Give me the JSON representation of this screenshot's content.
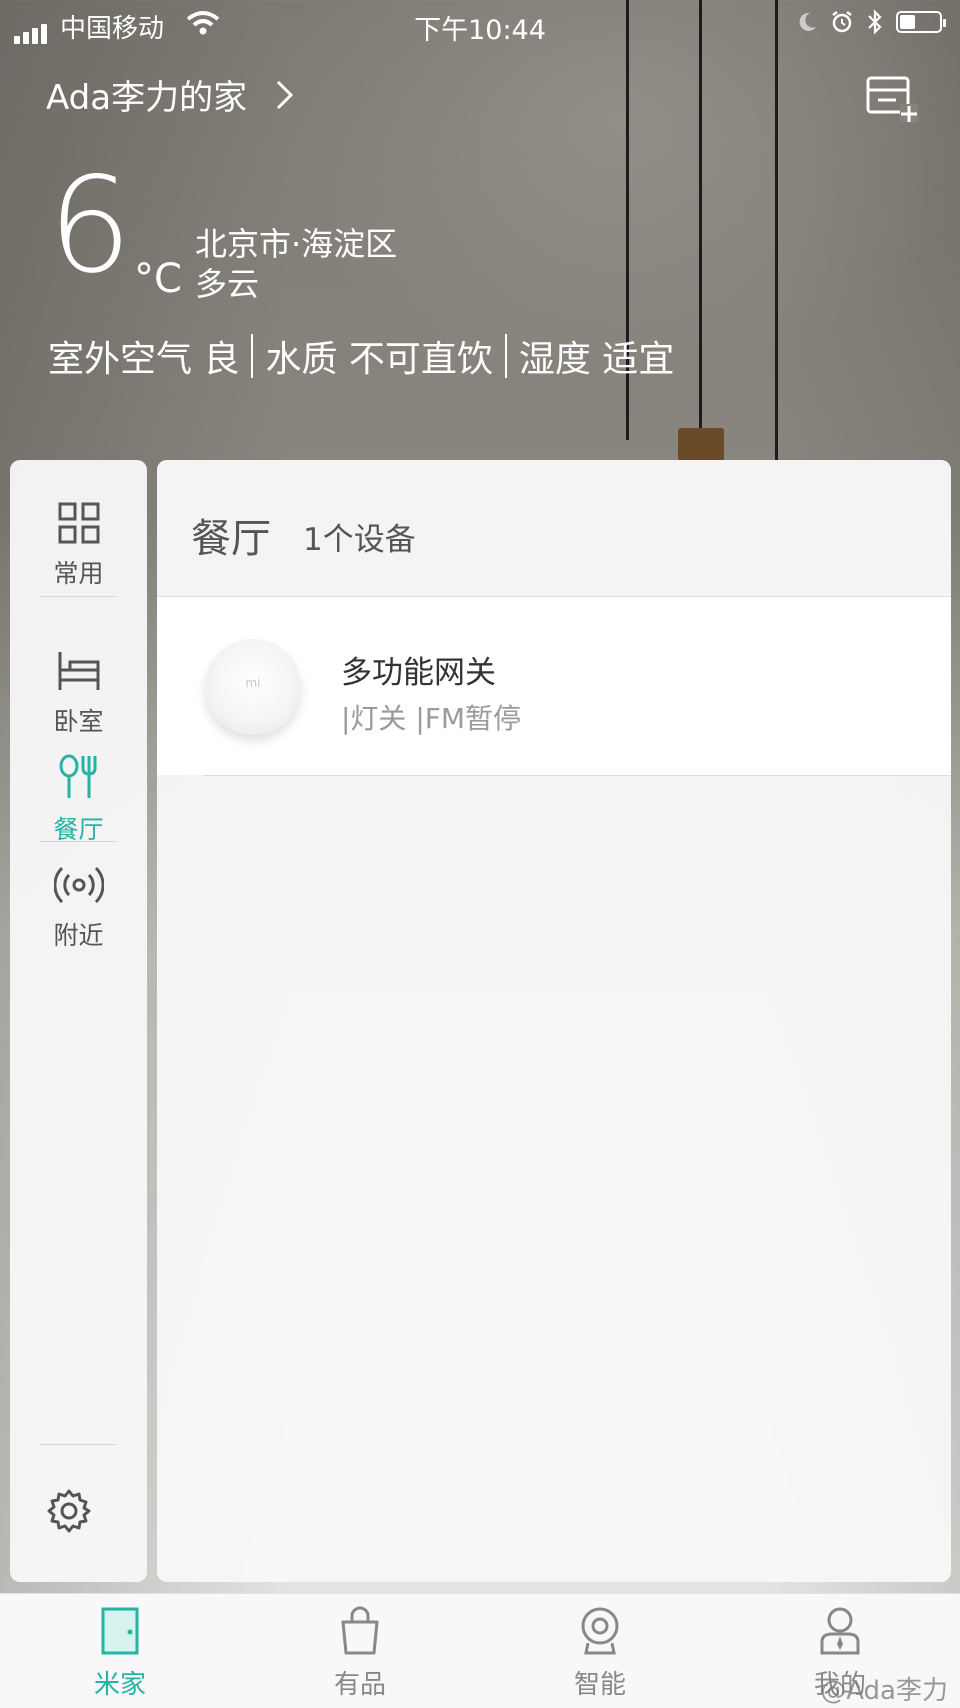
{
  "status_bar": {
    "carrier": "中国移动",
    "time": "下午10:44",
    "battery_level": 0.4
  },
  "header": {
    "home_name": "Ada李力的家",
    "chevron": "›"
  },
  "weather": {
    "temperature": "6",
    "unit": "°C",
    "location": "北京市·海淀区",
    "condition": "多云",
    "air": "室外空气 良",
    "water": "水质 不可直饮",
    "humidity": "湿度 适宜"
  },
  "sidebar": {
    "items": [
      {
        "label": "常用",
        "icon": "grid-icon"
      },
      {
        "label": "卧室",
        "icon": "bed-icon"
      },
      {
        "label": "餐厅",
        "icon": "dining-icon"
      },
      {
        "label": "附近",
        "icon": "nearby-icon"
      }
    ],
    "active": "餐厅"
  },
  "room": {
    "name": "餐厅",
    "count": "1个设备"
  },
  "devices": [
    {
      "name": "多功能网关",
      "status": "|灯关 |FM暂停",
      "logo": "mi"
    }
  ],
  "tabs": [
    {
      "label": "米家",
      "icon": "door-icon"
    },
    {
      "label": "有品",
      "icon": "bag-icon"
    },
    {
      "label": "智能",
      "icon": "camera-icon"
    },
    {
      "label": "我的",
      "icon": "person-icon"
    }
  ],
  "watermark": "@Ada李力",
  "colors": {
    "accent": "#26b3a3",
    "text_primary": "#333333",
    "text_secondary": "#9a9a9a"
  }
}
